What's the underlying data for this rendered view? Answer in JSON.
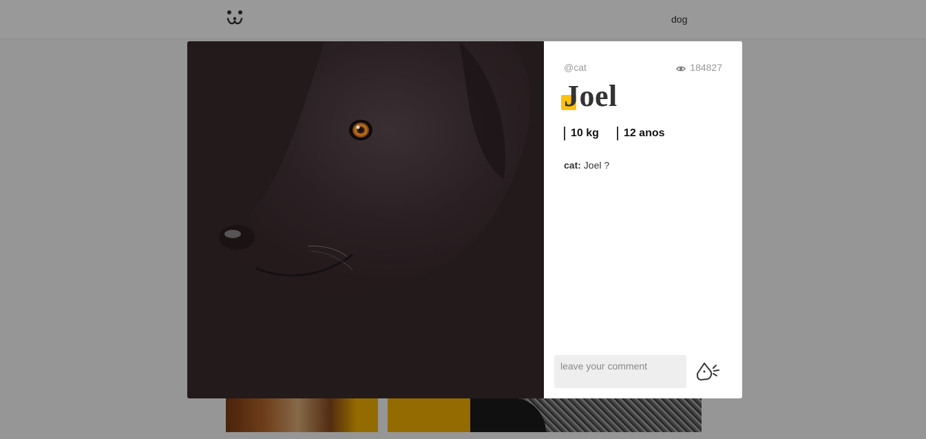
{
  "header": {
    "logo_icon": "dog-face-logo-icon",
    "nav_label": "dog"
  },
  "modal": {
    "author": "@cat",
    "views_icon": "eye-icon",
    "views": "184827",
    "title": "Joel",
    "accent_color": "#fbc10b",
    "attributes": [
      "10 kg",
      "12 anos"
    ],
    "comments": [
      {
        "author": "cat:",
        "text": "Joel ?"
      }
    ],
    "comment_placeholder": "leave your comment",
    "send_icon": "dog-bark-send-icon"
  }
}
